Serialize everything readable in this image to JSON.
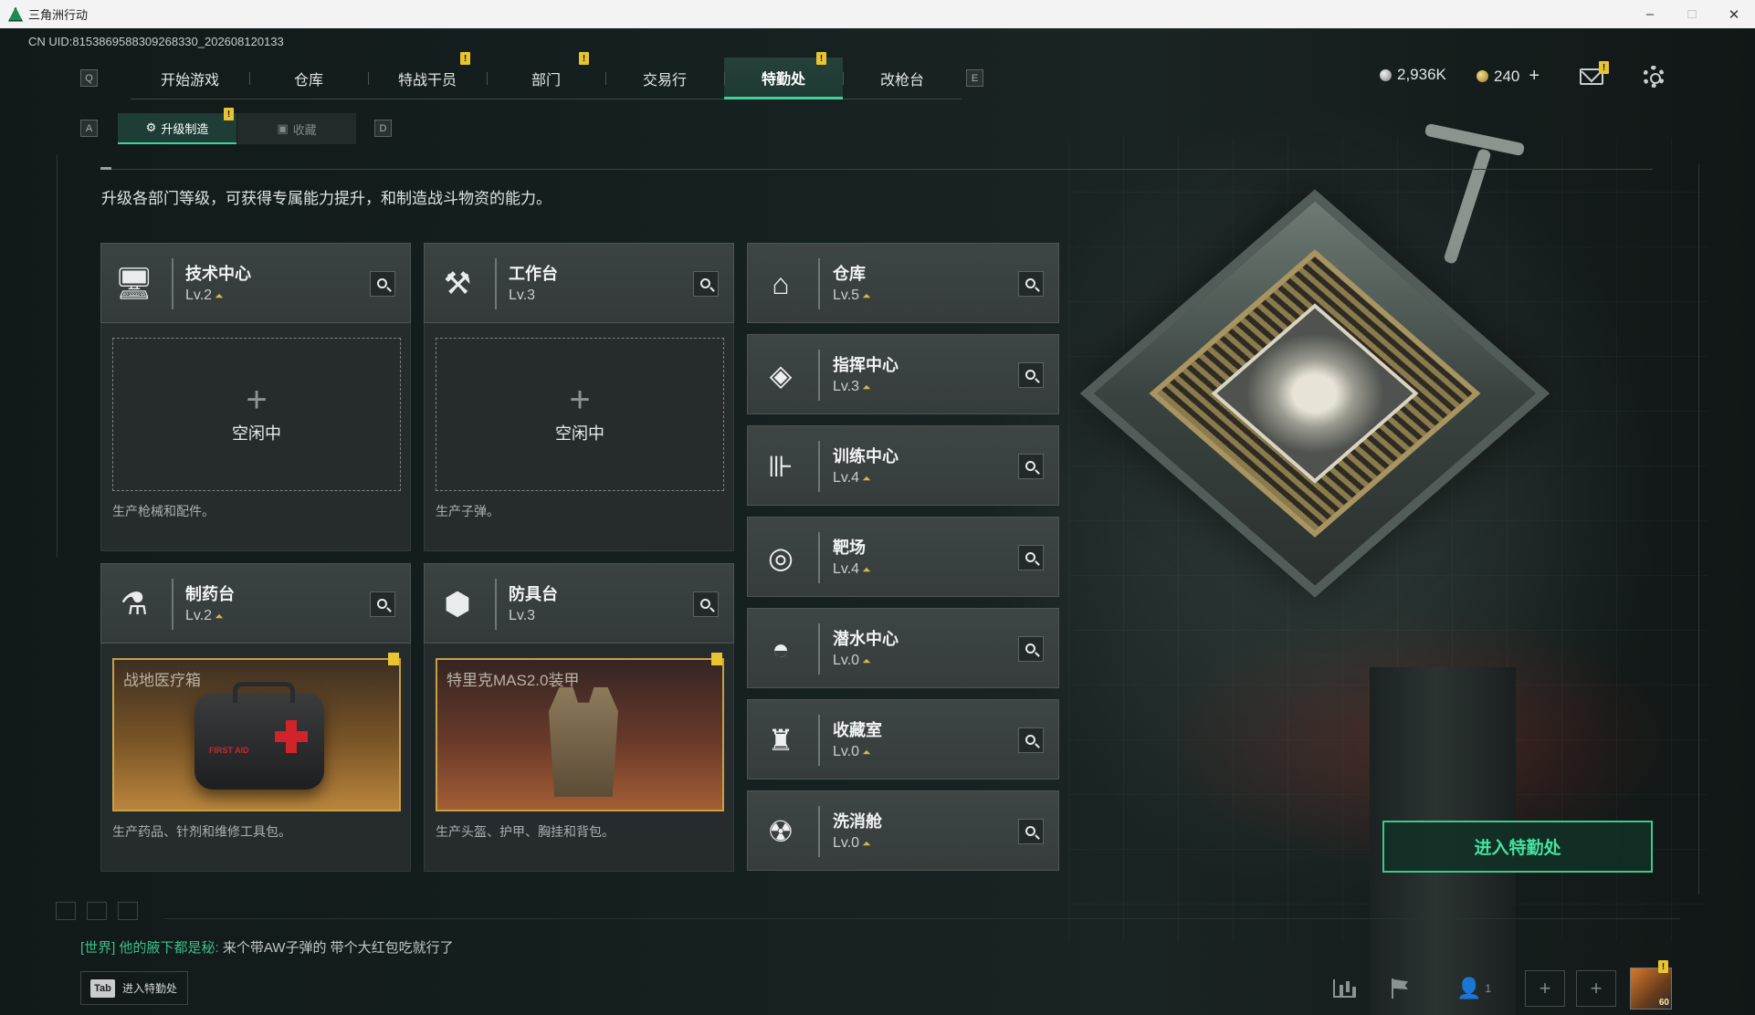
{
  "window": {
    "title": "三角洲行动",
    "controls": {
      "minimize": "–",
      "maximize": "□",
      "close": "✕"
    }
  },
  "uid": "CN UID:8153869588309268330_202608120133",
  "nav": {
    "left_key": "Q",
    "right_key": "E",
    "tabs": [
      {
        "label": "开始游戏",
        "active": false,
        "badge": false
      },
      {
        "label": "仓库",
        "active": false,
        "badge": false
      },
      {
        "label": "特战干员",
        "active": false,
        "badge": true
      },
      {
        "label": "部门",
        "active": false,
        "badge": true
      },
      {
        "label": "交易行",
        "active": false,
        "badge": false
      },
      {
        "label": "特勤处",
        "active": true,
        "badge": true
      },
      {
        "label": "改枪台",
        "active": false,
        "badge": false
      }
    ],
    "badge_text": "!"
  },
  "currency": {
    "silver": "2,936K",
    "gold": "240",
    "add": "+"
  },
  "subnav": {
    "left_key": "A",
    "right_key": "D",
    "tabs": [
      {
        "label": "升级制造",
        "icon": "⚙",
        "active": true
      },
      {
        "label": "收藏",
        "icon": "▣",
        "active": false
      }
    ]
  },
  "intro": "升级各部门等级，可获得专属能力提升，和制造战斗物资的能力。",
  "production": [
    {
      "name": "技术中心",
      "level": "Lv.2",
      "icon": "computer-icon",
      "glyph": "🖥",
      "status": "空闲中",
      "plus": "+",
      "desc": "生产枪械和配件。"
    },
    {
      "name": "工作台",
      "level": "Lv.3",
      "icon": "tools-icon",
      "glyph": "⚒",
      "status": "空闲中",
      "plus": "+",
      "desc": "生产子弹。"
    },
    {
      "name": "制药台",
      "level": "Lv.2",
      "icon": "microscope-icon",
      "glyph": "⚗",
      "product": "战地医疗箱",
      "product_label": "FIRST AID",
      "desc": "生产药品、针剂和维修工具包。"
    },
    {
      "name": "防具台",
      "level": "Lv.3",
      "icon": "cubes-icon",
      "glyph": "⬢",
      "product": "特里克MAS2.0装甲",
      "desc": "生产头盔、护甲、胸挂和背包。"
    }
  ],
  "facilities": [
    {
      "name": "仓库",
      "level": "Lv.5",
      "icon": "warehouse-icon",
      "glyph": "⌂"
    },
    {
      "name": "指挥中心",
      "level": "Lv.3",
      "icon": "command-icon",
      "glyph": "◈"
    },
    {
      "name": "训练中心",
      "level": "Lv.4",
      "icon": "dumbbell-icon",
      "glyph": "⊪"
    },
    {
      "name": "靶场",
      "level": "Lv.4",
      "icon": "target-icon",
      "glyph": "◎"
    },
    {
      "name": "潜水中心",
      "level": "Lv.0",
      "icon": "diving-mask-icon",
      "glyph": "◓"
    },
    {
      "name": "收藏室",
      "level": "Lv.0",
      "icon": "trophy-case-icon",
      "glyph": "♜"
    },
    {
      "name": "洗消舱",
      "level": "Lv.0",
      "icon": "hazmat-icon",
      "glyph": "☢"
    }
  ],
  "level_up_glyph": "⏶",
  "enter_button": "进入特勤处",
  "chat": {
    "channel": "[世界]",
    "sender": "他的腋下都是秘:",
    "message": "来个带AW子弹的  带个大红包吃就行了"
  },
  "tab_hint": {
    "key": "Tab",
    "label": "进入特勤处"
  },
  "bottom_bar": {
    "friends": "1",
    "add": "+",
    "avatar_level": "60"
  }
}
